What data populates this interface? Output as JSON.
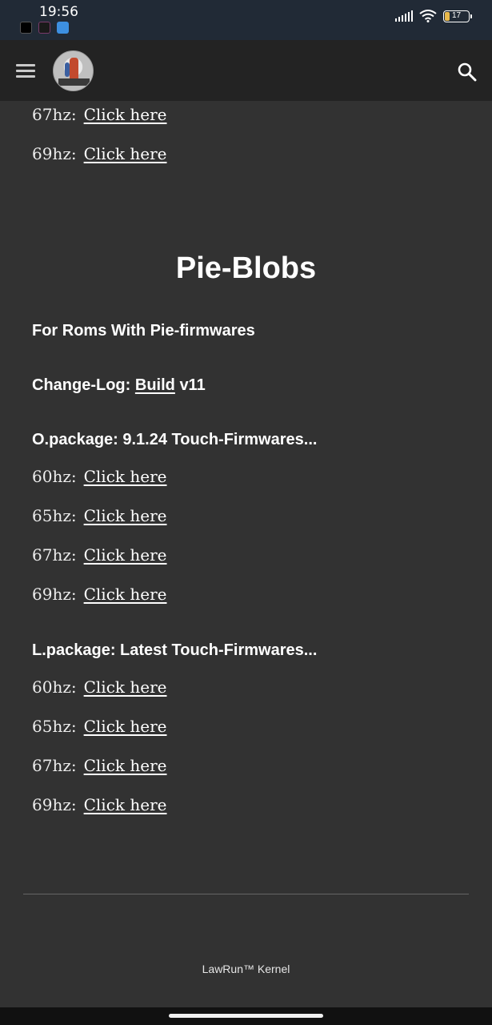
{
  "status_bar": {
    "time": "19:56",
    "battery_level": "17",
    "icons": [
      "signal-icon",
      "wifi-icon",
      "battery-icon"
    ]
  },
  "header": {
    "menu_icon": "menu-icon",
    "search_icon": "search-icon"
  },
  "top_links": [
    {
      "label": "67hz:",
      "link": "Click here"
    },
    {
      "label": "69hz:",
      "link": "Click here"
    }
  ],
  "section": {
    "title": "Pie-Blobs",
    "subtitle": "For Roms With Pie-firmwares",
    "changelog_prefix": "Change-Log:",
    "changelog_link": "Build",
    "changelog_version": "v11",
    "o_package_title": "O.package: 9.1.24 Touch-Firmwares...",
    "o_package_links": [
      {
        "label": "60hz:",
        "link": "Click here"
      },
      {
        "label": "65hz:",
        "link": "Click here"
      },
      {
        "label": "67hz:",
        "link": "Click here"
      },
      {
        "label": "69hz:",
        "link": "Click here"
      }
    ],
    "l_package_title": "L.package: Latest Touch-Firmwares...",
    "l_package_links": [
      {
        "label": "60hz:",
        "link": "Click here"
      },
      {
        "label": "65hz:",
        "link": "Click here"
      },
      {
        "label": "67hz:",
        "link": "Click here"
      },
      {
        "label": "69hz:",
        "link": "Click here"
      }
    ]
  },
  "footer": {
    "text": "LawRun™ Kernel"
  },
  "colors": {
    "page_bg": "#323232",
    "header_bg": "#232323",
    "status_bg": "#212a36",
    "battery_accent": "#e8b84a"
  }
}
